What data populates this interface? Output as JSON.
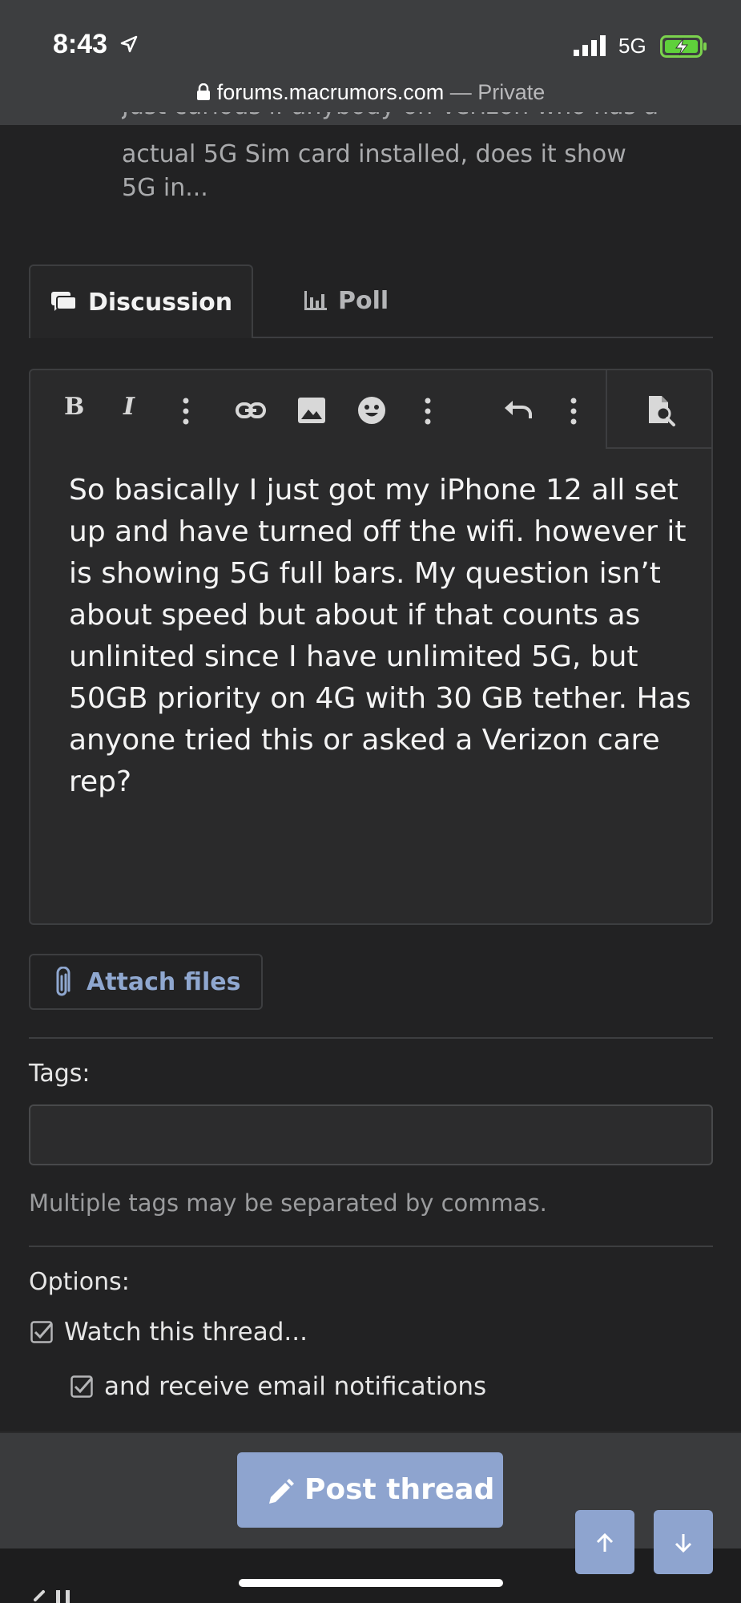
{
  "status": {
    "time": "8:43",
    "network": "5G"
  },
  "browser": {
    "domain": "forums.macrumors.com",
    "separator": " — ",
    "mode": "Private"
  },
  "snippet": {
    "cut_line": "Just curious if anybody on Verizon who has a",
    "lines": [
      "actual 5G Sim card installed, does it show",
      "5G in..."
    ]
  },
  "tabs": {
    "discussion": "Discussion",
    "poll": "Poll"
  },
  "toolbar": {
    "bold": "B",
    "italic": "I",
    "icons": [
      "more-vert-icon",
      "link-icon",
      "image-icon",
      "emoji-icon",
      "more-vert-icon",
      "undo-icon",
      "more-vert-icon",
      "preview-icon"
    ]
  },
  "editor": {
    "text": "So basically I just got my iPhone 12 all set up and have turned off the wifi. however it is showing 5G full bars. My question isn’t about speed but about if that counts as unlinited since I have unlimited 5G, but 50GB priority on 4G with 30 GB tether. Has anyone tried this or asked a Verizon care rep?"
  },
  "attach": {
    "label": "Attach files"
  },
  "tags": {
    "label": "Tags:",
    "value": "",
    "hint": "Multiple tags may be separated by commas."
  },
  "options": {
    "label": "Options:",
    "watch": "Watch this thread...",
    "email": "and receive email notifications",
    "watch_checked": true,
    "email_checked": true
  },
  "post_button": "Post thread",
  "colors": {
    "accent": "#8ea4cf",
    "background": "#222223",
    "link": "#8fa7cf"
  }
}
